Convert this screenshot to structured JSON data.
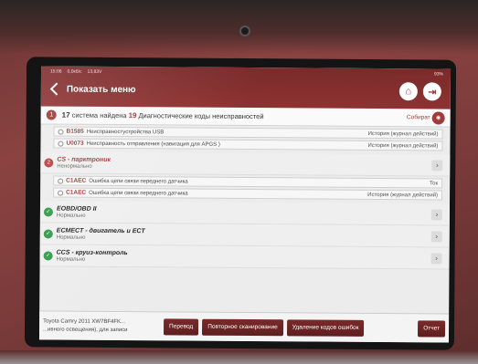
{
  "status_bar": {
    "time": "15:06",
    "network": "0,0кб/с",
    "voltage": "13,83V",
    "battery": "93%"
  },
  "header": {
    "title": "Показать меню",
    "home_icon": "home-icon",
    "exit_icon": "exit-icon",
    "accent_color": "#8e3232"
  },
  "summary": {
    "index": "1",
    "systems_count": "17",
    "systems_text": "система найдена",
    "codes_count": "19",
    "codes_text": "Диагностические коды неисправностей",
    "collect_label": "Собират"
  },
  "groups": [
    {
      "codes": [
        {
          "code": "B1585",
          "description": "Неисправностустройства USB",
          "status": "История (журнал действий)"
        },
        {
          "code": "U0073",
          "description": "Неисправность отправления (навигация для APGS )",
          "status": "История (журнал действий)"
        }
      ]
    }
  ],
  "systems": [
    {
      "index": "2",
      "name": "CS - парктроник",
      "state": "Ненормально",
      "status": "error"
    },
    {
      "index": "",
      "name": "EOBD/OBD II",
      "state": "Нормально",
      "status": "ok"
    },
    {
      "index": "",
      "name": "ECMECT - двигатель и ECT",
      "state": "Нормально",
      "status": "ok"
    },
    {
      "index": "",
      "name": "CCS - круиз-контроль",
      "state": "Нормально",
      "status": "ok"
    }
  ],
  "parking_codes": [
    {
      "code": "C1AEC",
      "description": "Ошибка цепи связи переднего датчика",
      "status": "Ток"
    },
    {
      "code": "C1AEC",
      "description": "Ошибка цепи связи переднего датчика",
      "status": "История (журнал действий)"
    }
  ],
  "bottom": {
    "vehicle_line1": "Toyota Camry 2011  XW7BF4FK...",
    "vehicle_line2": "...ивного освещения), для записи",
    "buttons": {
      "translate": "Перевод",
      "rescan": "Повторное сканирование",
      "clear_codes": "Удаление кодов ошибок",
      "report": "Отчет"
    }
  }
}
